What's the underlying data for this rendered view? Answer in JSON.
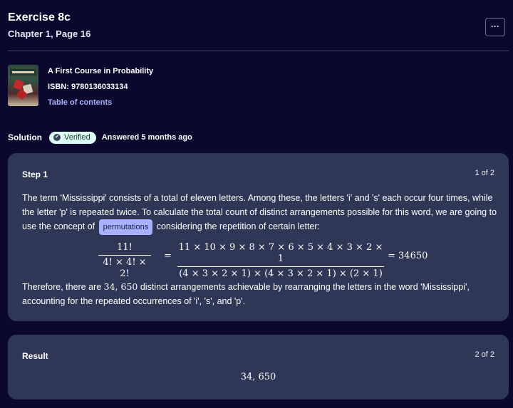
{
  "header": {
    "title": "Exercise 8c",
    "subtitle": "Chapter 1, Page 16",
    "more_label": "···"
  },
  "book": {
    "title": "A First Course in Probability",
    "isbn": "ISBN: 9780136033134",
    "toc_label": "Table of contents",
    "cover_text": "PROBABILITY"
  },
  "solution": {
    "label": "Solution",
    "verified_label": "Verified",
    "answered": "Answered 5 months ago"
  },
  "step": {
    "label": "Step 1",
    "count": "1 of 2",
    "para1_a": "The term 'Mississippi' consists of a total of eleven letters. Among these, the letters 'i' and 's' each occur four times, while the letter 'p' is repeated twice. To calculate the total count of distinct arrangements possible for this word, we are going to use the concept of",
    "chip": "permutations",
    "para1_b": "considering the repetition of certain letter:",
    "math": {
      "frac1_num": "11!",
      "frac1_den": "4! × 4! × 2!",
      "eq": "=",
      "frac2_num": "11 × 10 × 9 × 8 × 7 × 6 × 5 × 4 × 3 × 2 × 1",
      "frac2_den": "(4 × 3 × 2 × 1) × (4 × 3 × 2 × 1) × (2 × 1)",
      "result": "= 34650"
    },
    "para2_a": "Therefore, there are",
    "para2_value": "34, 650",
    "para2_b": "distinct arrangements achievable by rearranging the letters in the word 'Mississippi', accounting for the repeated occurrences of 'i', 's', and 'p'."
  },
  "result": {
    "label": "Result",
    "count": "2 of 2",
    "value": "34, 650"
  },
  "colors": {
    "background": "#0a092d",
    "card": "#2e3856",
    "accent": "#a8b1ff",
    "verified_bg": "#dafcf2"
  }
}
